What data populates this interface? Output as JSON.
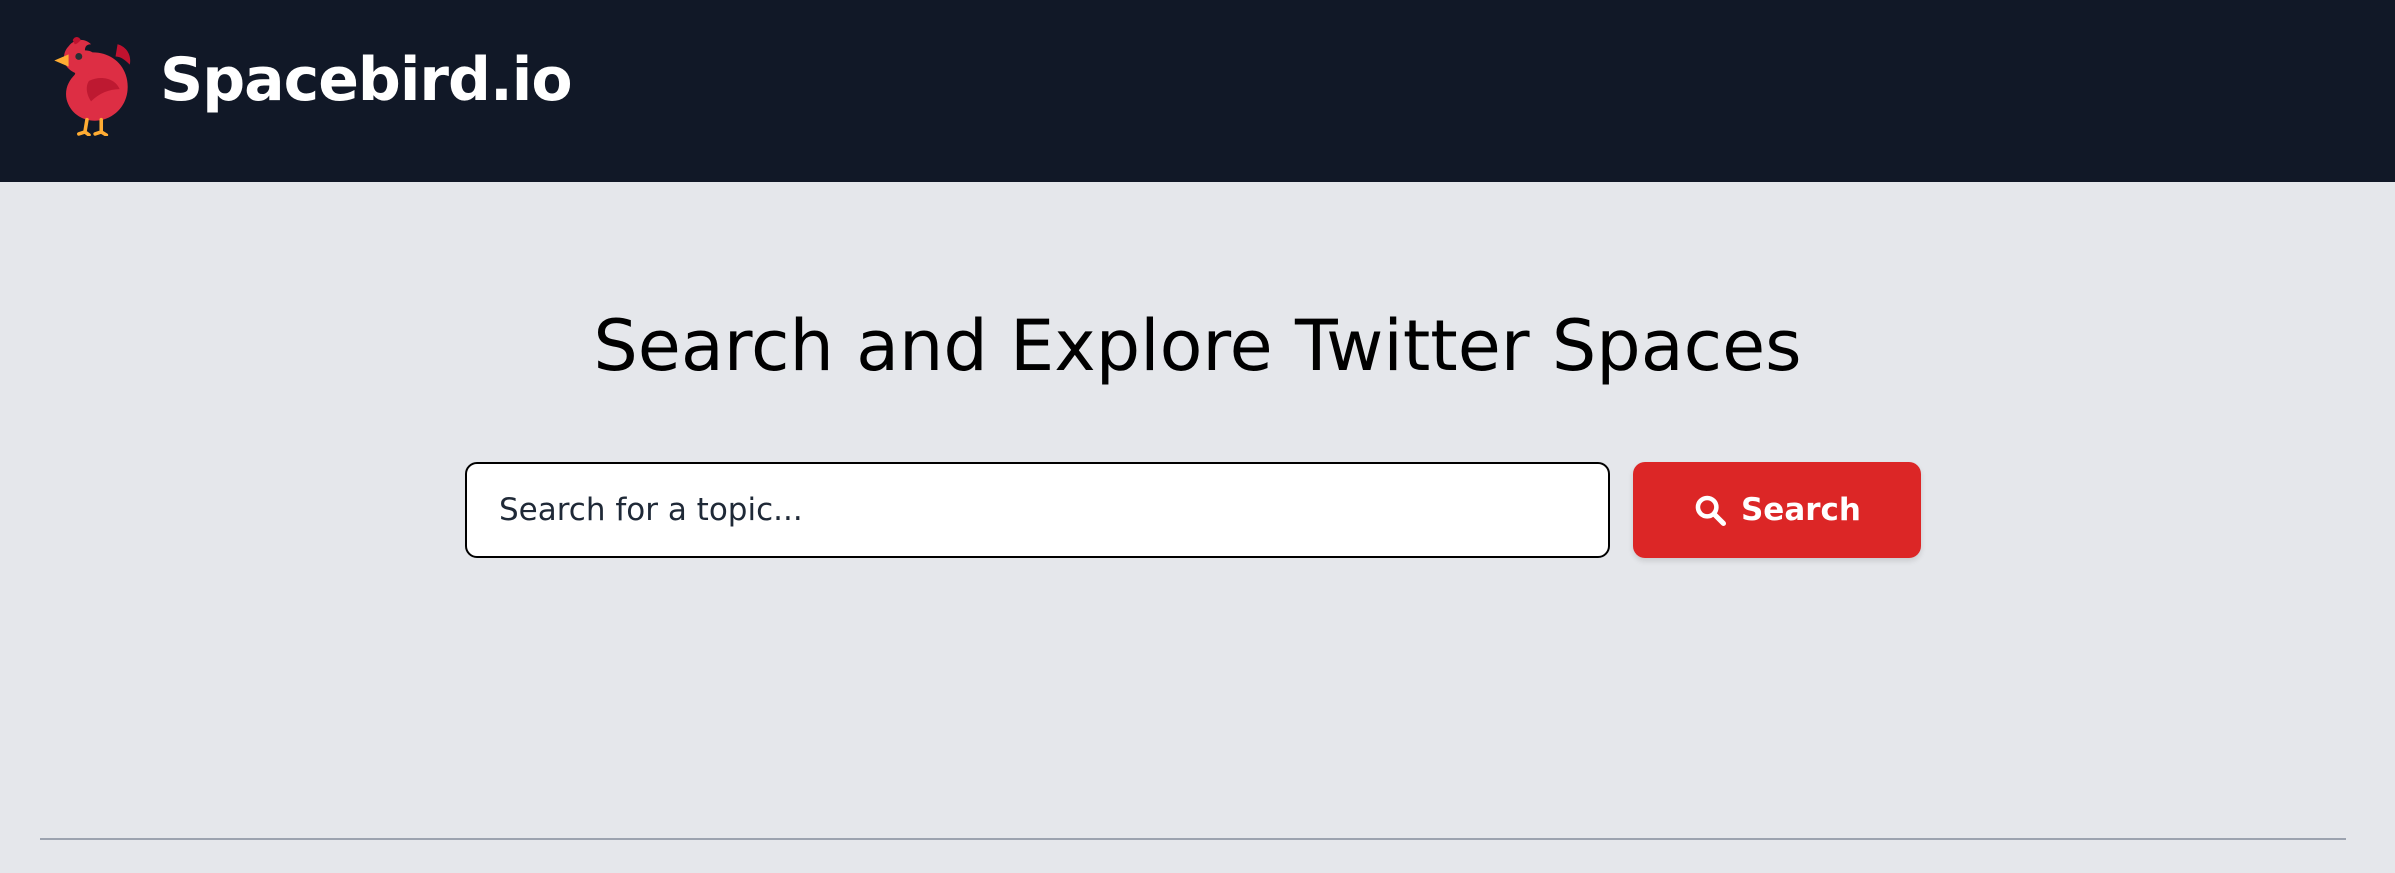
{
  "header": {
    "brand": "Spacebird.io",
    "logo_icon": "red-bird-icon"
  },
  "hero": {
    "title": "Search and Explore Twitter Spaces"
  },
  "search": {
    "placeholder": "Search for a topic...",
    "value": "",
    "button_label": "Search",
    "button_icon": "search-icon"
  },
  "colors": {
    "header_bg": "#111827",
    "page_bg": "#e5e7eb",
    "accent": "#dc2626"
  }
}
